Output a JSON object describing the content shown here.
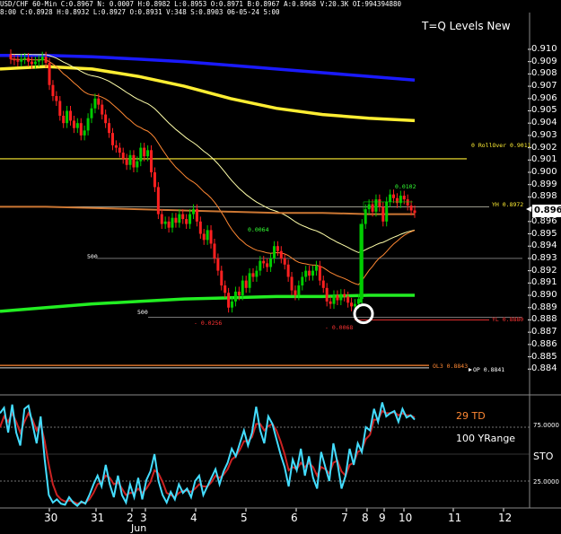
{
  "header": {
    "line1": "USD/CHF 60-Min  C:0.8967  N:  0.0007  H:0.8982  L:0.8953  O:0.8971  B:0.8967  A:0.8968  V:20.3K  OI:994394880",
    "line2": "8:00  C:0.8928  H:0.8932  L:0.8927  O:0.8931  V:348  S:0.8903  06-05-24  5:00"
  },
  "title": "T=Q Levels New",
  "current_price_box": "0.896",
  "annotations": {
    "rollover": "0  RollOver  0.9011",
    "yh": "YH  0.8972",
    "yl": "YL  0.8880",
    "ol3": "OL3  0.8843",
    "op": "OP  0.8841",
    "peak": "0.0102",
    "mid": "0.0064",
    "drop1": "-  0.0256",
    "drop2": "-  0.0068",
    "five_hundred_a": "500",
    "five_hundred_b": "500"
  },
  "indicator_labels": {
    "td": "29 TD",
    "yrange": "100 YRange",
    "sto": "STO",
    "level_high": "75.0000",
    "level_low": "25.0000"
  },
  "colors": {
    "background": "#000000",
    "up_candle": "#00cc00",
    "down_candle": "#ff2020",
    "blue_ma": "#1a1aff",
    "yellow_ma": "#ffee33",
    "light_yellow_ma": "#ffffaa",
    "orange_ma": "#ff8833",
    "green_ma": "#22ee22",
    "sto_fast": "#44ddff",
    "sto_slow": "#cc2222"
  },
  "chart_data": {
    "type": "candlestick",
    "symbol": "USD/CHF",
    "timeframe": "60-Min",
    "x_tick_labels": [
      "30",
      "31",
      "2",
      "3",
      "4",
      "5",
      "6",
      "7",
      "8",
      "9",
      "10",
      "11",
      "12"
    ],
    "month_label": "Jun",
    "y_tick_labels": [
      "0.910",
      "0.909",
      "0.908",
      "0.907",
      "0.906",
      "0.905",
      "0.904",
      "0.903",
      "0.902",
      "0.901",
      "0.900",
      "0.899",
      "0.898",
      "0.897",
      "0.896",
      "0.895",
      "0.894",
      "0.893",
      "0.892",
      "0.891",
      "0.890",
      "0.889",
      "0.888",
      "0.887",
      "0.886",
      "0.885",
      "0.884"
    ],
    "ylim": [
      0.8838,
      0.9108
    ],
    "horizontal_levels": {
      "rollover": 0.9011,
      "yh": 0.8972,
      "yl": 0.888,
      "ol3": 0.8843,
      "op": 0.8841,
      "level_500_upper": 0.893,
      "level_500_lower": 0.8882
    },
    "close_series": [
      0.9092,
      0.9091,
      0.909,
      0.9092,
      0.9093,
      0.909,
      0.9088,
      0.909,
      0.9091,
      0.9094,
      0.9089,
      0.9071,
      0.9062,
      0.9058,
      0.9046,
      0.904,
      0.905,
      0.9042,
      0.9036,
      0.904,
      0.903,
      0.9034,
      0.9044,
      0.9052,
      0.906,
      0.9055,
      0.9047,
      0.904,
      0.9032,
      0.9022,
      0.902,
      0.9016,
      0.9011,
      0.9006,
      0.9014,
      0.9004,
      0.9009,
      0.902,
      0.9013,
      0.9018,
      0.9,
      0.8988,
      0.8966,
      0.8958,
      0.896,
      0.8955,
      0.8963,
      0.8959,
      0.8966,
      0.8962,
      0.8958,
      0.8966,
      0.897,
      0.896,
      0.895,
      0.8945,
      0.8953,
      0.8942,
      0.893,
      0.892,
      0.8908,
      0.8902,
      0.889,
      0.8895,
      0.8903,
      0.89,
      0.8912,
      0.8906,
      0.8918,
      0.8915,
      0.892,
      0.8928,
      0.8926,
      0.8923,
      0.893,
      0.894,
      0.8936,
      0.893,
      0.8925,
      0.8915,
      0.8904,
      0.89,
      0.8908,
      0.8915,
      0.892,
      0.8916,
      0.892,
      0.8924,
      0.8912,
      0.8906,
      0.8895,
      0.8893,
      0.89,
      0.8896,
      0.8901,
      0.8899,
      0.8894,
      0.8891,
      0.8893,
      0.8897,
      0.8958,
      0.897,
      0.8974,
      0.8968,
      0.8978,
      0.8972,
      0.896,
      0.8976,
      0.8982,
      0.8979,
      0.8975,
      0.8981,
      0.8978,
      0.8973,
      0.8969,
      0.8967
    ],
    "stochastic": {
      "name": "STO",
      "levels": [
        75,
        25
      ],
      "fast": [
        88,
        93,
        70,
        96,
        70,
        58,
        92,
        95,
        78,
        60,
        85,
        45,
        12,
        5,
        8,
        4,
        3,
        10,
        5,
        2,
        6,
        4,
        12,
        22,
        30,
        20,
        40,
        22,
        10,
        30,
        12,
        5,
        22,
        10,
        28,
        8,
        26,
        34,
        50,
        25,
        12,
        5,
        15,
        8,
        22,
        14,
        18,
        10,
        25,
        30,
        12,
        20,
        28,
        36,
        22,
        34,
        42,
        55,
        48,
        60,
        72,
        58,
        70,
        94,
        72,
        60,
        85,
        78,
        64,
        50,
        38,
        20,
        45,
        35,
        55,
        30,
        48,
        28,
        18,
        52,
        38,
        25,
        60,
        42,
        18,
        30,
        55,
        40,
        60,
        52,
        75,
        72,
        92,
        80,
        98,
        85,
        88,
        90,
        80,
        92,
        84,
        86,
        82
      ],
      "slow": [
        75,
        85,
        80,
        88,
        80,
        70,
        80,
        88,
        82,
        72,
        78,
        62,
        40,
        22,
        12,
        8,
        6,
        7,
        6,
        4,
        5,
        5,
        8,
        14,
        22,
        24,
        30,
        28,
        22,
        24,
        18,
        12,
        14,
        14,
        18,
        14,
        18,
        24,
        35,
        32,
        24,
        14,
        12,
        10,
        14,
        16,
        16,
        15,
        18,
        22,
        20,
        20,
        24,
        30,
        28,
        31,
        36,
        45,
        48,
        54,
        62,
        62,
        66,
        78,
        78,
        72,
        76,
        78,
        72,
        62,
        50,
        35,
        38,
        36,
        42,
        38,
        42,
        38,
        30,
        38,
        36,
        32,
        42,
        44,
        34,
        30,
        40,
        42,
        52,
        54,
        64,
        68,
        82,
        82,
        90,
        88,
        88,
        89,
        86,
        88,
        86,
        86,
        84
      ]
    }
  }
}
